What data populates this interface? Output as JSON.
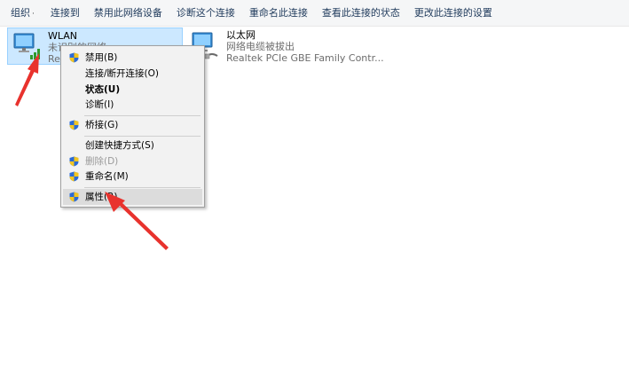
{
  "toolbar": {
    "items": [
      {
        "label": "组织"
      },
      {
        "label": "连接到"
      },
      {
        "label": "禁用此网络设备"
      },
      {
        "label": "诊断这个连接"
      },
      {
        "label": "重命名此连接"
      },
      {
        "label": "查看此连接的状态"
      },
      {
        "label": "更改此连接的设置"
      }
    ],
    "organize_caret": "·"
  },
  "connections": [
    {
      "name": "WLAN",
      "status": "未识别的网络",
      "adapter": "Realtek"
    },
    {
      "name": "以太网",
      "status": "网络电缆被拔出",
      "adapter": "Realtek PCIe GBE Family Contr..."
    }
  ],
  "context_menu": {
    "items": [
      {
        "label": "禁用(B)"
      },
      {
        "label": "连接/断开连接(O)"
      },
      {
        "label": "状态(U)"
      },
      {
        "label": "诊断(I)"
      },
      {
        "label": "桥接(G)"
      },
      {
        "label": "创建快捷方式(S)"
      },
      {
        "label": "删除(D)"
      },
      {
        "label": "重命名(M)"
      },
      {
        "label": "属性(R)"
      }
    ]
  },
  "colors": {
    "selection_bg": "#cce8ff",
    "annotation_red": "#e8322d",
    "menu_bg": "#f2f2f2"
  }
}
